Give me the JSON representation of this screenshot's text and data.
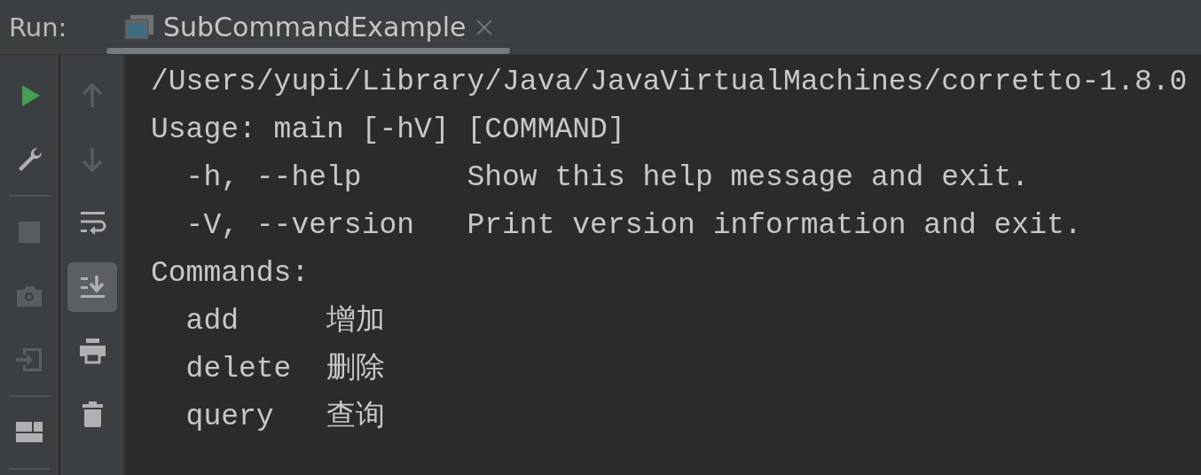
{
  "header": {
    "label": "Run:",
    "tabs": [
      {
        "title": "SubCommandExample",
        "selected": true
      }
    ]
  },
  "left_toolbar": [
    {
      "kind": "run",
      "disabled": false
    },
    {
      "kind": "wrench",
      "disabled": false
    },
    {
      "kind": "separator"
    },
    {
      "kind": "stop",
      "disabled": true
    },
    {
      "kind": "camera",
      "disabled": true
    },
    {
      "kind": "login",
      "disabled": true
    },
    {
      "kind": "separator"
    },
    {
      "kind": "layout",
      "disabled": false
    },
    {
      "kind": "separator"
    }
  ],
  "right_toolbar": [
    {
      "kind": "up",
      "disabled": true,
      "on": false
    },
    {
      "kind": "down",
      "disabled": true,
      "on": false
    },
    {
      "kind": "wrap",
      "disabled": false,
      "on": false
    },
    {
      "kind": "scroll-end",
      "disabled": false,
      "on": true
    },
    {
      "kind": "print",
      "disabled": false,
      "on": false
    },
    {
      "kind": "trash",
      "disabled": false,
      "on": false
    }
  ],
  "console": {
    "lines": [
      "/Users/yupi/Library/Java/JavaVirtualMachines/corretto-1.8.0",
      "Usage: main [-hV] [COMMAND]",
      "  -h, --help      Show this help message and exit.",
      "  -V, --version   Print version information and exit.",
      "Commands:",
      "  add     增加",
      "  delete  删除",
      "  query   查询"
    ]
  }
}
